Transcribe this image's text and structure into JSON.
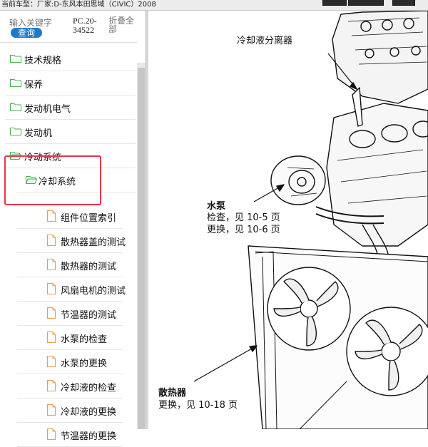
{
  "window": {
    "title": "当前车型：厂家:D-东风本田思域（CIVIC）2008"
  },
  "search": {
    "placeholder": "输入关键字",
    "button_label": "查询",
    "page_ref": "PC.20-34522",
    "collapse_label": "折叠全部"
  },
  "tree": {
    "items": [
      {
        "label": "技术规格",
        "type": "folder",
        "level": 0
      },
      {
        "label": "保养",
        "type": "folder",
        "level": 0
      },
      {
        "label": "发动机电气",
        "type": "folder",
        "level": 0
      },
      {
        "label": "发动机",
        "type": "folder",
        "level": 0
      },
      {
        "label": "冷动系统",
        "type": "folder-open",
        "level": 0
      },
      {
        "label": "冷却系统",
        "type": "folder-open",
        "level": 1
      },
      {
        "label": "组件位置索引",
        "type": "doc",
        "level": 2
      },
      {
        "label": "散热器盖的测试",
        "type": "doc",
        "level": 2
      },
      {
        "label": "散热器的测试",
        "type": "doc",
        "level": 2
      },
      {
        "label": "风扇电机的测试",
        "type": "doc",
        "level": 2
      },
      {
        "label": "节温器的测试",
        "type": "doc",
        "level": 2
      },
      {
        "label": "水泵的检查",
        "type": "doc",
        "level": 2
      },
      {
        "label": "水泵的更换",
        "type": "doc",
        "level": 2
      },
      {
        "label": "冷却液的检查",
        "type": "doc",
        "level": 2
      },
      {
        "label": "冷却液的更换",
        "type": "doc",
        "level": 2
      },
      {
        "label": "节温器的更换",
        "type": "doc",
        "level": 2
      }
    ]
  },
  "diagram": {
    "separator_label": "冷却液分离器",
    "pump_title": "水泵",
    "pump_line1": "检查，见 10-5 页",
    "pump_line2": "更换，见 10-6 页",
    "radiator_title": "散热器",
    "radiator_line1": "更换，见 10-18 页"
  },
  "colors": {
    "accent": "#1e79c6",
    "highlight": "#e8354c",
    "folder": "#4caf50"
  }
}
